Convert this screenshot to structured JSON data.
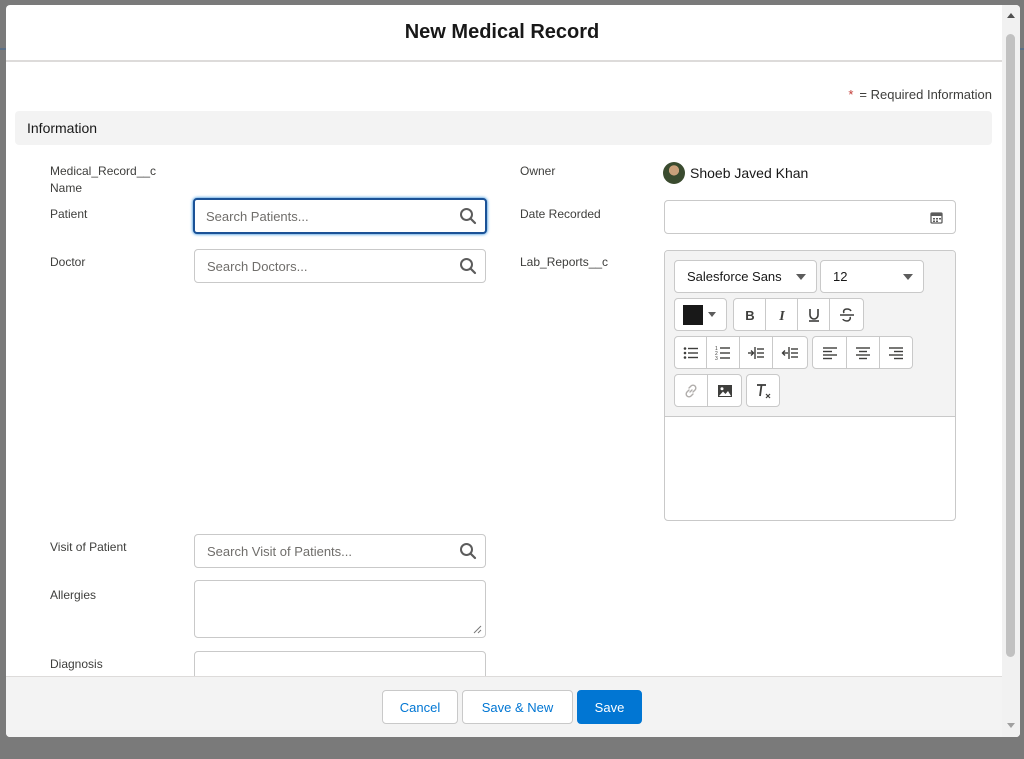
{
  "modal": {
    "title": "New Medical Record"
  },
  "required_note": {
    "star": "*",
    "text": "= Required Information"
  },
  "section": {
    "title": "Information"
  },
  "fields": {
    "name_label_line1": "Medical_Record__c",
    "name_label_line2": "Name",
    "patient_label": "Patient",
    "patient_placeholder": "Search Patients...",
    "doctor_label": "Doctor",
    "doctor_placeholder": "Search Doctors...",
    "visit_label": "Visit of Patient",
    "visit_placeholder": "Search Visit of Patients...",
    "allergies_label": "Allergies",
    "diagnosis_label": "Diagnosis",
    "owner_label": "Owner",
    "owner_value": "Shoeb Javed Khan",
    "date_label": "Date Recorded",
    "lab_label": "Lab_Reports__c"
  },
  "editor": {
    "font_family": "Salesforce Sans",
    "font_size": "12",
    "text_color": "#181818",
    "icons": [
      "text-color-icon",
      "bold-icon",
      "italic-icon",
      "underline-icon",
      "strikethrough-icon",
      "bulleted-list-icon",
      "numbered-list-icon",
      "indent-icon",
      "outdent-icon",
      "align-left-icon",
      "align-center-icon",
      "align-right-icon",
      "link-icon",
      "image-icon",
      "remove-formatting-icon"
    ]
  },
  "buttons": {
    "cancel": "Cancel",
    "save_new": "Save & New",
    "save": "Save"
  },
  "colors": {
    "brand": "#0176d3",
    "focus_border": "#1b5297",
    "required": "#c23934"
  }
}
